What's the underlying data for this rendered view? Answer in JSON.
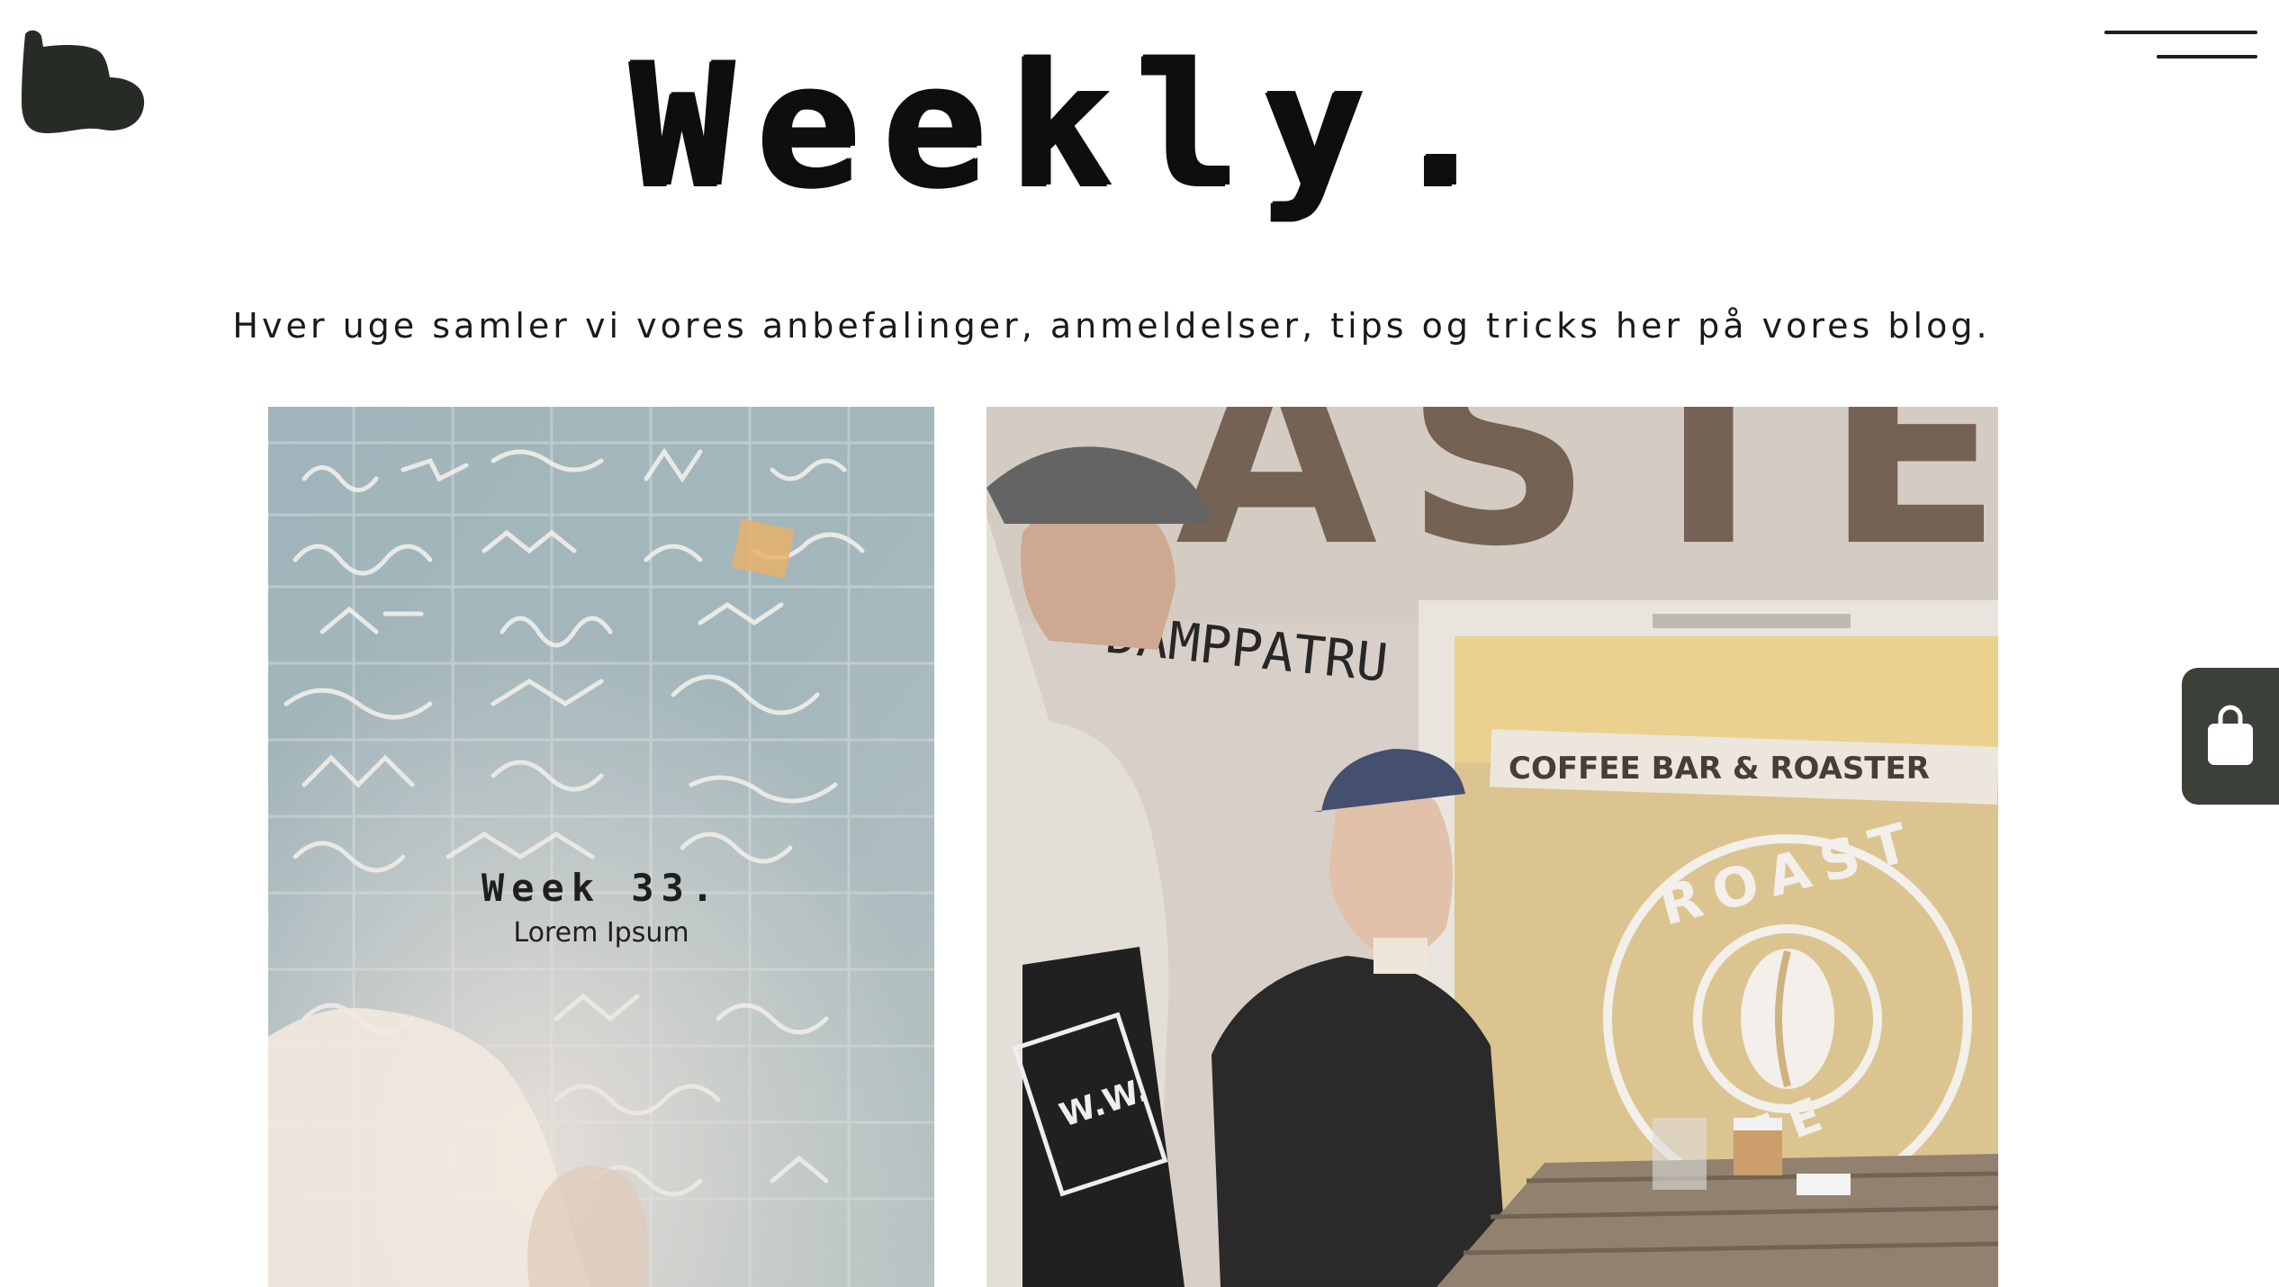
{
  "header": {
    "title": "Weekly.",
    "logo_icon": "blob-logo-icon",
    "menu_icon": "hamburger-menu-icon"
  },
  "tagline": "Hver uge samler vi vores anbefalinger, anmeldelser, tips og tricks her på vores blog.",
  "posts": [
    {
      "title": "Week 33.",
      "subtitle": "Lorem Ipsum"
    }
  ],
  "photo_right": {
    "sign_top": "ASTER",
    "sign_bar": "COFFEE BAR & ROASTER",
    "window_logo": "ROAST",
    "window_logo_bottom": "EE",
    "graffiti": "DAMPPATRU",
    "bag_text": "W.W."
  },
  "cart": {
    "icon": "shopping-bag-icon"
  },
  "colors": {
    "accent_dark": "#3b4038",
    "logo": "#262b25"
  }
}
